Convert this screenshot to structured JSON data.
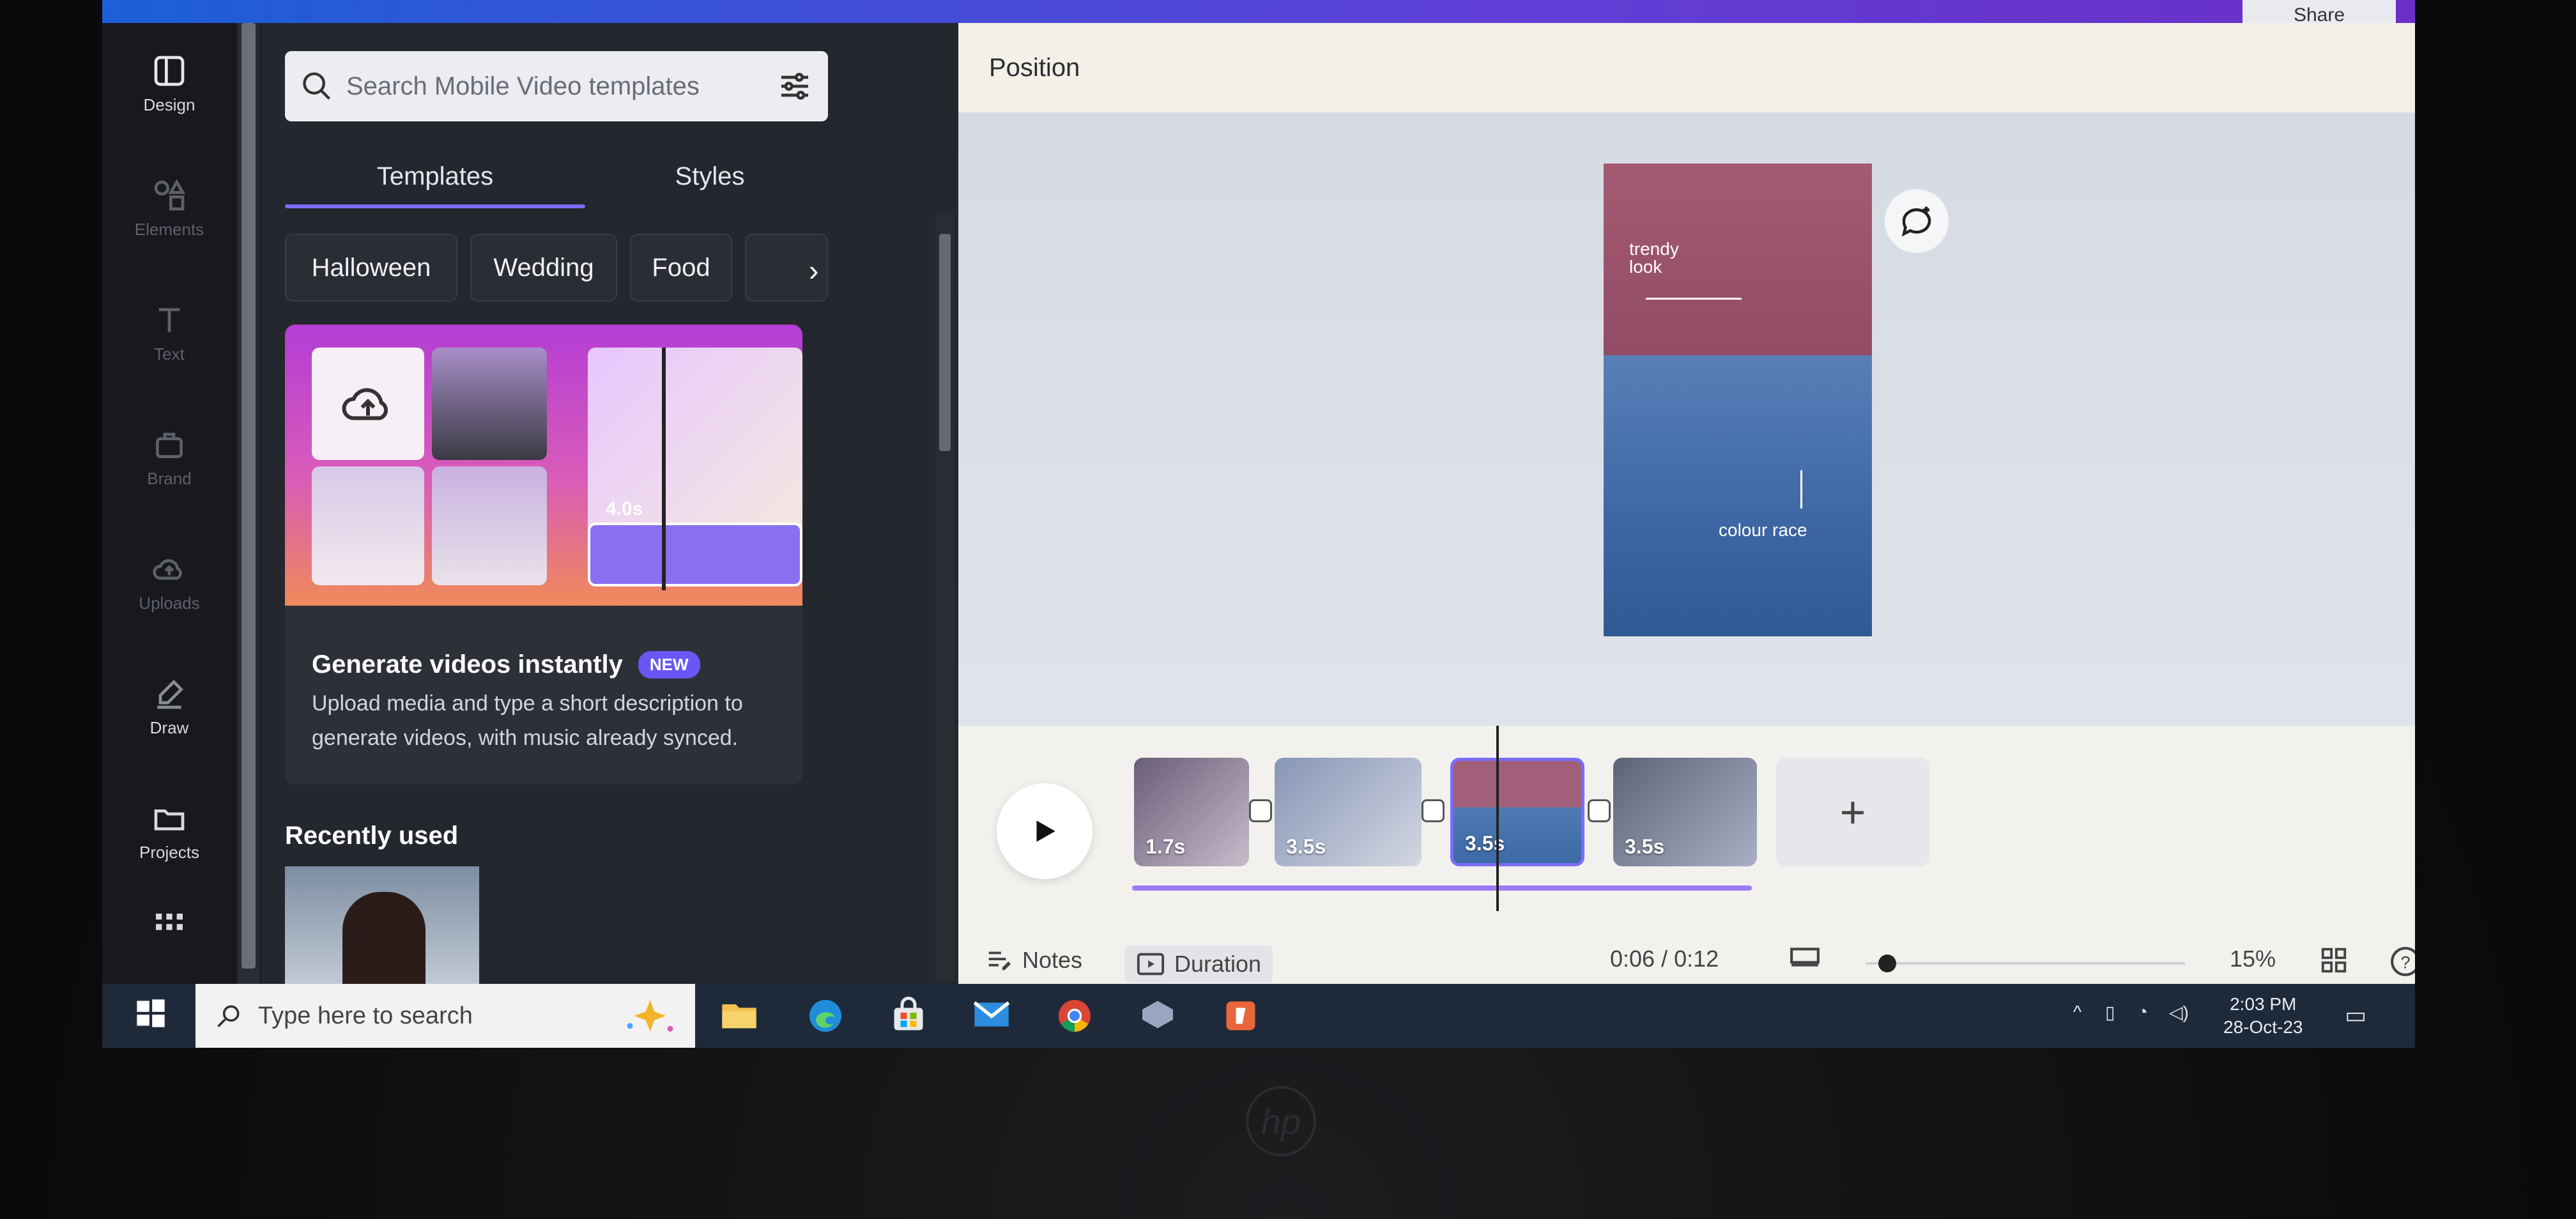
{
  "topbar": {
    "share_label": "Share"
  },
  "rail": {
    "items": [
      {
        "label": "Design"
      },
      {
        "label": "Elements"
      },
      {
        "label": "Text"
      },
      {
        "label": "Brand"
      },
      {
        "label": "Uploads"
      },
      {
        "label": "Draw"
      },
      {
        "label": "Projects"
      }
    ]
  },
  "panel": {
    "search_placeholder": "Search Mobile Video templates",
    "tabs": [
      {
        "label": "Templates"
      },
      {
        "label": "Styles"
      }
    ],
    "chips": [
      {
        "label": "Halloween"
      },
      {
        "label": "Wedding"
      },
      {
        "label": "Food"
      }
    ],
    "promo": {
      "title": "Generate videos instantly",
      "badge": "NEW",
      "description": "Upload media and type a short description to generate videos, with music already synced.",
      "clip_duration": "4.0s"
    },
    "recent_title": "Recently used"
  },
  "editor": {
    "position_label": "Position",
    "design_text_1": "trendy look",
    "design_text_2": "colour race",
    "clips": [
      {
        "duration": "1.7s"
      },
      {
        "duration": "3.5s"
      },
      {
        "duration": "3.5s"
      },
      {
        "duration": "3.5s"
      }
    ],
    "notes_label": "Notes",
    "duration_label": "Duration",
    "time_readout": "0:06 / 0:12",
    "zoom": "15%"
  },
  "taskbar": {
    "search_placeholder": "Type here to search",
    "time": "2:03 PM",
    "date": "28-Oct-23"
  },
  "colors": {
    "accent": "#7b6cff",
    "timeline_progress": "#9b7af5",
    "badge": "#6b56f5"
  }
}
